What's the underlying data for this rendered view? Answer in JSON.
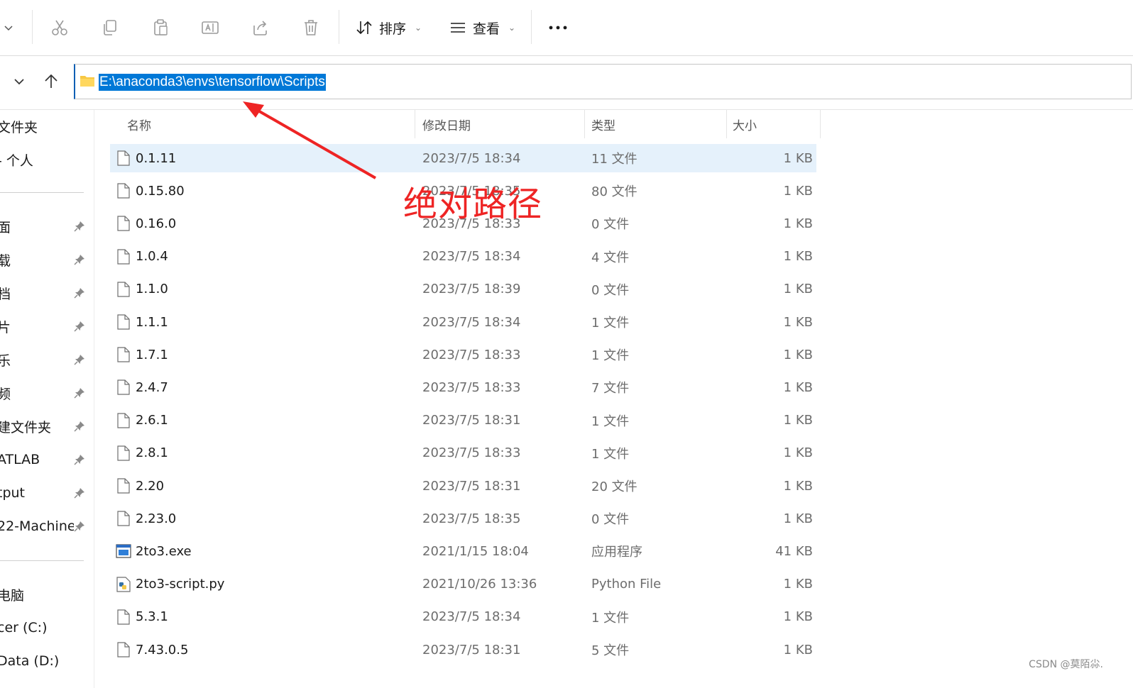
{
  "toolbar": {
    "sort_label": "排序",
    "view_label": "查看",
    "more_label": "···",
    "icons": [
      "cut-icon",
      "copy-icon",
      "paste-icon",
      "rename-icon",
      "share-icon",
      "delete-icon"
    ]
  },
  "address": {
    "path": "E:\\anaconda3\\envs\\tensorflow\\Scripts"
  },
  "sidebar": {
    "items": [
      {
        "label": "文件夹",
        "pinned": false
      },
      {
        "label": "- 个人",
        "pinned": false
      },
      {
        "label": "面",
        "pinned": true
      },
      {
        "label": "载",
        "pinned": true
      },
      {
        "label": "档",
        "pinned": true
      },
      {
        "label": "片",
        "pinned": true
      },
      {
        "label": "乐",
        "pinned": true
      },
      {
        "label": "频",
        "pinned": true
      },
      {
        "label": "建文件夹",
        "pinned": true
      },
      {
        "label": "ATLAB",
        "pinned": true
      },
      {
        "label": "tput",
        "pinned": true
      },
      {
        "label": "22-Machine-",
        "pinned": true
      },
      {
        "label": "电脑",
        "pinned": false
      },
      {
        "label": "cer (C:)",
        "pinned": false
      },
      {
        "label": "Data (D:)",
        "pinned": false
      }
    ]
  },
  "columns": {
    "name": "名称",
    "date": "修改日期",
    "type": "类型",
    "size": "大小"
  },
  "files": [
    {
      "name": "0.1.11",
      "date": "2023/7/5 18:34",
      "type": "11 文件",
      "size": "1 KB",
      "icon": "file-icon",
      "selected": true
    },
    {
      "name": "0.15.80",
      "date": "2023/7/5 18:35",
      "type": "80 文件",
      "size": "1 KB",
      "icon": "file-icon"
    },
    {
      "name": "0.16.0",
      "date": "2023/7/5 18:33",
      "type": "0 文件",
      "size": "1 KB",
      "icon": "file-icon"
    },
    {
      "name": "1.0.4",
      "date": "2023/7/5 18:34",
      "type": "4 文件",
      "size": "1 KB",
      "icon": "file-icon"
    },
    {
      "name": "1.1.0",
      "date": "2023/7/5 18:39",
      "type": "0 文件",
      "size": "1 KB",
      "icon": "file-icon"
    },
    {
      "name": "1.1.1",
      "date": "2023/7/5 18:34",
      "type": "1 文件",
      "size": "1 KB",
      "icon": "file-icon"
    },
    {
      "name": "1.7.1",
      "date": "2023/7/5 18:33",
      "type": "1 文件",
      "size": "1 KB",
      "icon": "file-icon"
    },
    {
      "name": "2.4.7",
      "date": "2023/7/5 18:33",
      "type": "7 文件",
      "size": "1 KB",
      "icon": "file-icon"
    },
    {
      "name": "2.6.1",
      "date": "2023/7/5 18:31",
      "type": "1 文件",
      "size": "1 KB",
      "icon": "file-icon"
    },
    {
      "name": "2.8.1",
      "date": "2023/7/5 18:33",
      "type": "1 文件",
      "size": "1 KB",
      "icon": "file-icon"
    },
    {
      "name": "2.20",
      "date": "2023/7/5 18:31",
      "type": "20 文件",
      "size": "1 KB",
      "icon": "file-icon"
    },
    {
      "name": "2.23.0",
      "date": "2023/7/5 18:35",
      "type": "0 文件",
      "size": "1 KB",
      "icon": "file-icon"
    },
    {
      "name": "2to3.exe",
      "date": "2021/1/15 18:04",
      "type": "应用程序",
      "size": "41 KB",
      "icon": "exe-icon"
    },
    {
      "name": "2to3-script.py",
      "date": "2021/10/26 13:36",
      "type": "Python File",
      "size": "1 KB",
      "icon": "python-file-icon"
    },
    {
      "name": "5.3.1",
      "date": "2023/7/5 18:34",
      "type": "1 文件",
      "size": "1 KB",
      "icon": "file-icon"
    },
    {
      "name": "7.43.0.5",
      "date": "2023/7/5 18:31",
      "type": "5 文件",
      "size": "1 KB",
      "icon": "file-icon"
    }
  ],
  "annotation": {
    "text": "绝对路径",
    "color": "#ee2424"
  },
  "watermark": "CSDN @莫陌尛."
}
